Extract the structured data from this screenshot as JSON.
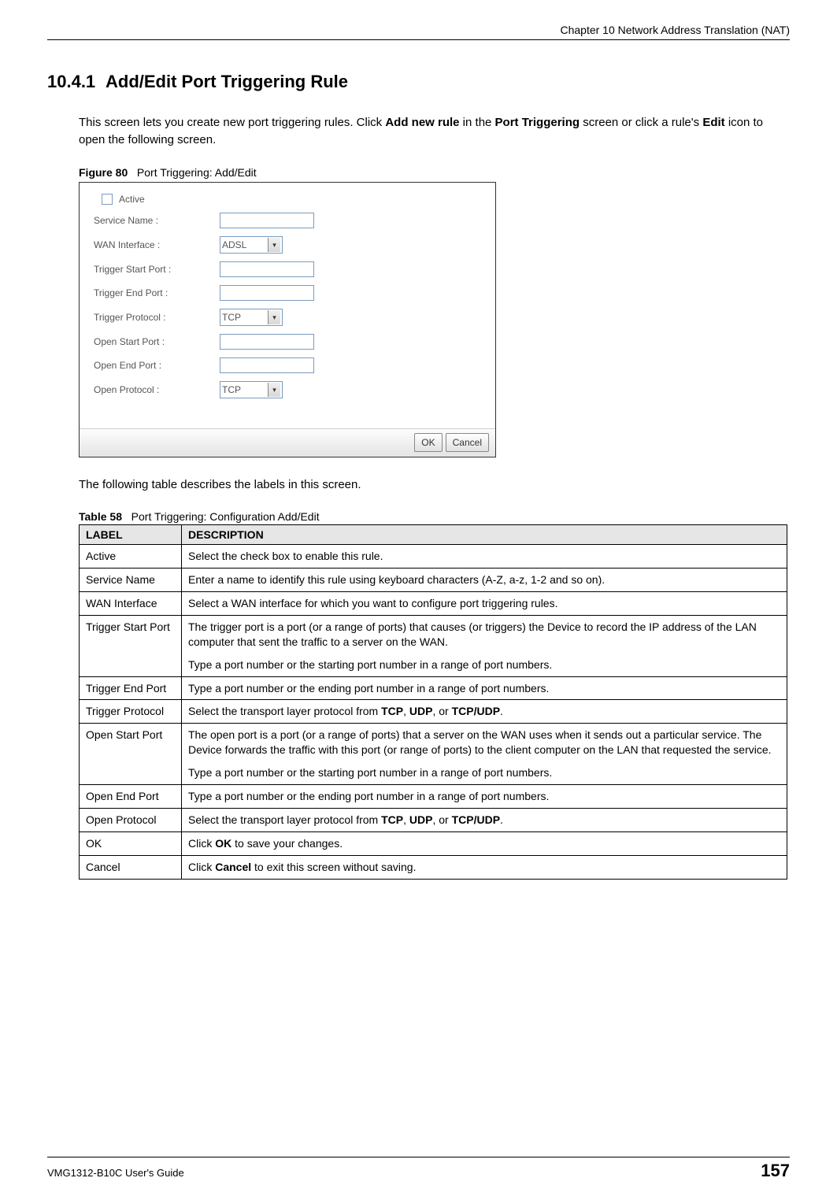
{
  "header": {
    "chapter_text": "Chapter 10 Network Address Translation (NAT)"
  },
  "section": {
    "number": "10.4.1",
    "title": "Add/Edit Port Triggering Rule"
  },
  "intro": {
    "pre": "This screen lets you create new port triggering rules. Click ",
    "bold1": "Add new rule",
    "mid1": " in the ",
    "bold2": "Port Triggering",
    "mid2": " screen or click a rule's ",
    "bold3": "Edit",
    "post": " icon to open the following screen."
  },
  "figure": {
    "label": "Figure 80",
    "caption": "Port Triggering: Add/Edit",
    "form": {
      "active_label": "Active",
      "service_name_label": "Service Name :",
      "wan_interface_label": "WAN Interface :",
      "wan_interface_value": "ADSL",
      "trigger_start_label": "Trigger Start Port :",
      "trigger_end_label": "Trigger End Port :",
      "trigger_protocol_label": "Trigger Protocol :",
      "trigger_protocol_value": "TCP",
      "open_start_label": "Open Start Port :",
      "open_end_label": "Open End Port :",
      "open_protocol_label": "Open Protocol :",
      "open_protocol_value": "TCP"
    },
    "buttons": {
      "ok": "OK",
      "cancel": "Cancel"
    }
  },
  "table_intro": "The following table describes the labels in this screen.",
  "table": {
    "label": "Table 58",
    "caption": "Port Triggering: Configuration Add/Edit",
    "header": {
      "col1": "LABEL",
      "col2": "DESCRIPTION"
    },
    "rows": [
      {
        "label": "Active",
        "desc": "Select the check box to enable this rule."
      },
      {
        "label": "Service Name",
        "desc": "Enter a name to identify this rule using keyboard characters (A-Z, a-z, 1-2 and so on)."
      },
      {
        "label": "WAN Interface",
        "desc": "Select a WAN interface for which you want to configure port triggering rules."
      },
      {
        "label": "Trigger Start Port",
        "desc": "The trigger port is a port (or a range of ports) that causes (or triggers) the Device to record the IP address of the LAN computer that sent the traffic to a server on the WAN.",
        "desc2": "Type a port number or the starting port number in a range of port numbers."
      },
      {
        "label": "Trigger End Port",
        "desc": "Type a port number or the ending port number in a range of port numbers."
      },
      {
        "label": "Trigger Protocol",
        "desc_pre": "Select the transport layer protocol from ",
        "b1": "TCP",
        "sep1": ", ",
        "b2": "UDP",
        "sep2": ", or ",
        "b3": "TCP/UDP",
        "desc_post": "."
      },
      {
        "label": "Open Start Port",
        "desc": "The open port is a port (or a range of ports) that a server on the WAN uses when it sends out a particular service. The Device forwards the traffic with this port (or range of ports) to the client computer on the LAN that requested the service.",
        "desc2": "Type a port number or the starting port number in a range of port numbers."
      },
      {
        "label": "Open End Port",
        "desc": "Type a port number or the ending port number in a range of port numbers."
      },
      {
        "label": "Open Protocol",
        "desc_pre": "Select the transport layer protocol from ",
        "b1": "TCP",
        "sep1": ", ",
        "b2": "UDP",
        "sep2": ", or ",
        "b3": "TCP/UDP",
        "desc_post": "."
      },
      {
        "label": "OK",
        "desc_pre": "Click ",
        "b1": "OK",
        "desc_post": " to save your changes."
      },
      {
        "label": "Cancel",
        "desc_pre": "Click ",
        "b1": "Cancel",
        "desc_post": " to exit this screen without saving."
      }
    ]
  },
  "footer": {
    "guide": "VMG1312-B10C User's Guide",
    "page": "157"
  }
}
